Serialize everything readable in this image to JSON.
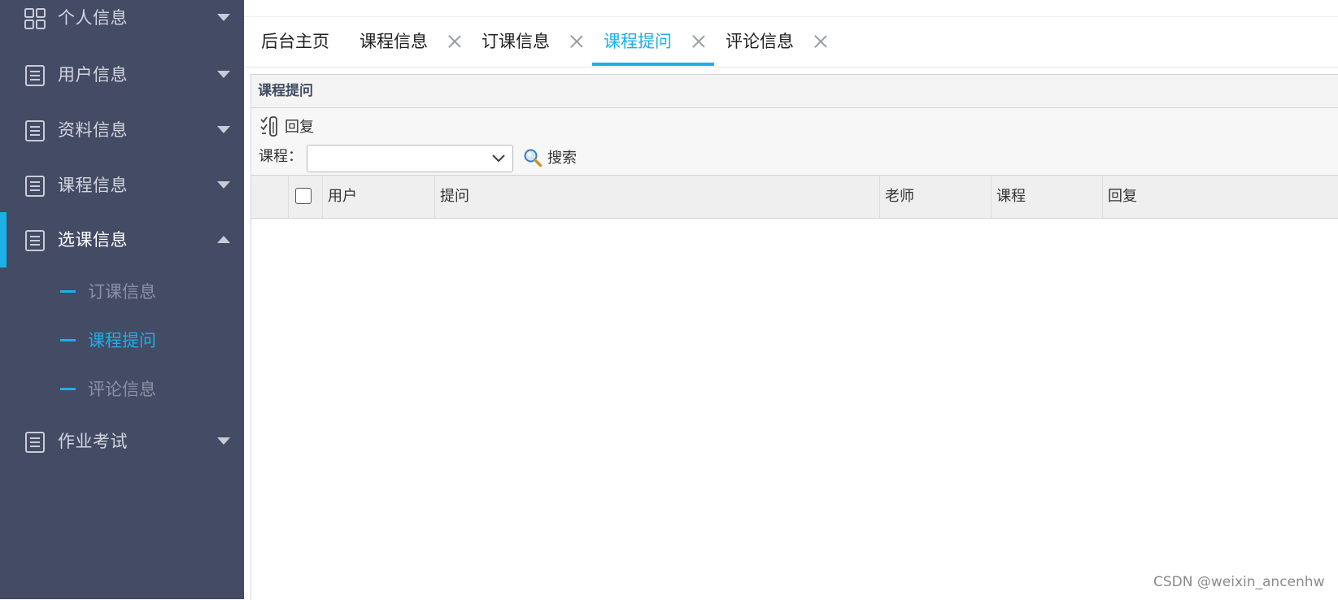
{
  "sidebar": {
    "menus": [
      {
        "label": "个人信息",
        "icon": "grid-icon",
        "expanded": false
      },
      {
        "label": "用户信息",
        "icon": "document-icon",
        "expanded": false
      },
      {
        "label": "资料信息",
        "icon": "document-icon",
        "expanded": false
      },
      {
        "label": "课程信息",
        "icon": "document-icon",
        "expanded": false
      },
      {
        "label": "选课信息",
        "icon": "document-icon",
        "expanded": true,
        "active": true
      },
      {
        "label": "作业考试",
        "icon": "document-icon",
        "expanded": false
      }
    ],
    "submenu": [
      {
        "label": "订课信息",
        "current": false
      },
      {
        "label": "课程提问",
        "current": true
      },
      {
        "label": "评论信息",
        "current": false
      }
    ]
  },
  "tabs": [
    {
      "label": "后台主页",
      "closable": false,
      "active": false
    },
    {
      "label": "课程信息",
      "closable": true,
      "active": false
    },
    {
      "label": "订课信息",
      "closable": true,
      "active": false
    },
    {
      "label": "课程提问",
      "closable": true,
      "active": true
    },
    {
      "label": "评论信息",
      "closable": true,
      "active": false
    }
  ],
  "panel": {
    "title": "课程提问",
    "toolbar": {
      "reply_label": "回复",
      "filter_label": "课程：",
      "course_select_value": "",
      "search_label": "搜索"
    },
    "grid": {
      "columns": [
        "用户",
        "提问",
        "老师",
        "课程",
        "回复"
      ],
      "rows": []
    }
  },
  "watermark": "CSDN @weixin_ancenhw",
  "colors": {
    "sidebar_bg": "#434b65",
    "accent": "#1cb0e6",
    "panel_header_bg": "#f4f4f4",
    "grid_header_bg": "#efefef"
  }
}
